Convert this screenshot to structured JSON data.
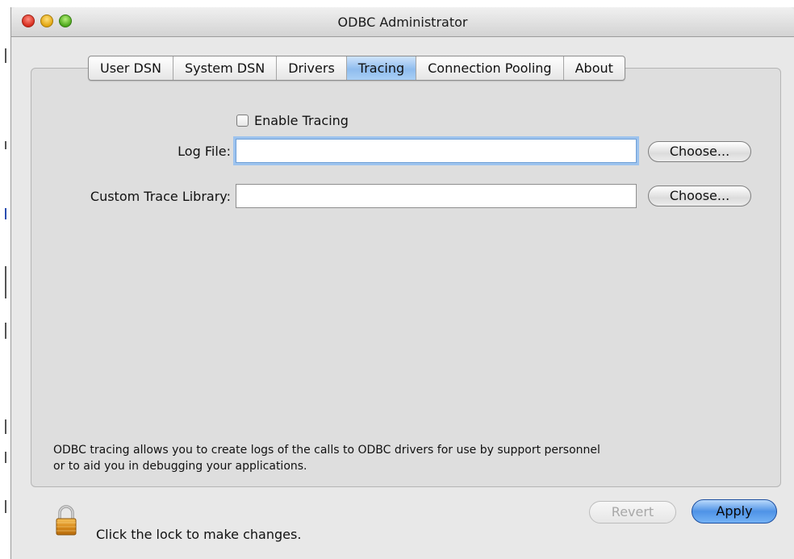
{
  "window": {
    "title": "ODBC Administrator"
  },
  "tabs": [
    {
      "label": "User DSN",
      "active": false
    },
    {
      "label": "System DSN",
      "active": false
    },
    {
      "label": "Drivers",
      "active": false
    },
    {
      "label": "Tracing",
      "active": true
    },
    {
      "label": "Connection Pooling",
      "active": false
    },
    {
      "label": "About",
      "active": false
    }
  ],
  "tracing": {
    "enable_label": "Enable Tracing",
    "enable_checked": false,
    "log_file_label": "Log File:",
    "log_file_value": "",
    "custom_lib_label": "Custom Trace Library:",
    "custom_lib_value": "",
    "choose_label": "Choose...",
    "description_line1": "ODBC tracing allows you to create logs of the calls to ODBC drivers for use by support personnel",
    "description_line2": "or to aid you in debugging your applications."
  },
  "footer": {
    "lock_text": "Click the lock to make changes.",
    "revert_label": "Revert",
    "apply_label": "Apply"
  },
  "icons": {
    "lock": "lock-icon",
    "close": "close-icon",
    "minimize": "minimize-icon",
    "zoom": "zoom-icon"
  },
  "colors": {
    "active_tab": "#8fbcee",
    "apply_button": "#4f93e6",
    "close": "#d62d1e",
    "minimize": "#e2a510",
    "zoom": "#4da81c"
  }
}
